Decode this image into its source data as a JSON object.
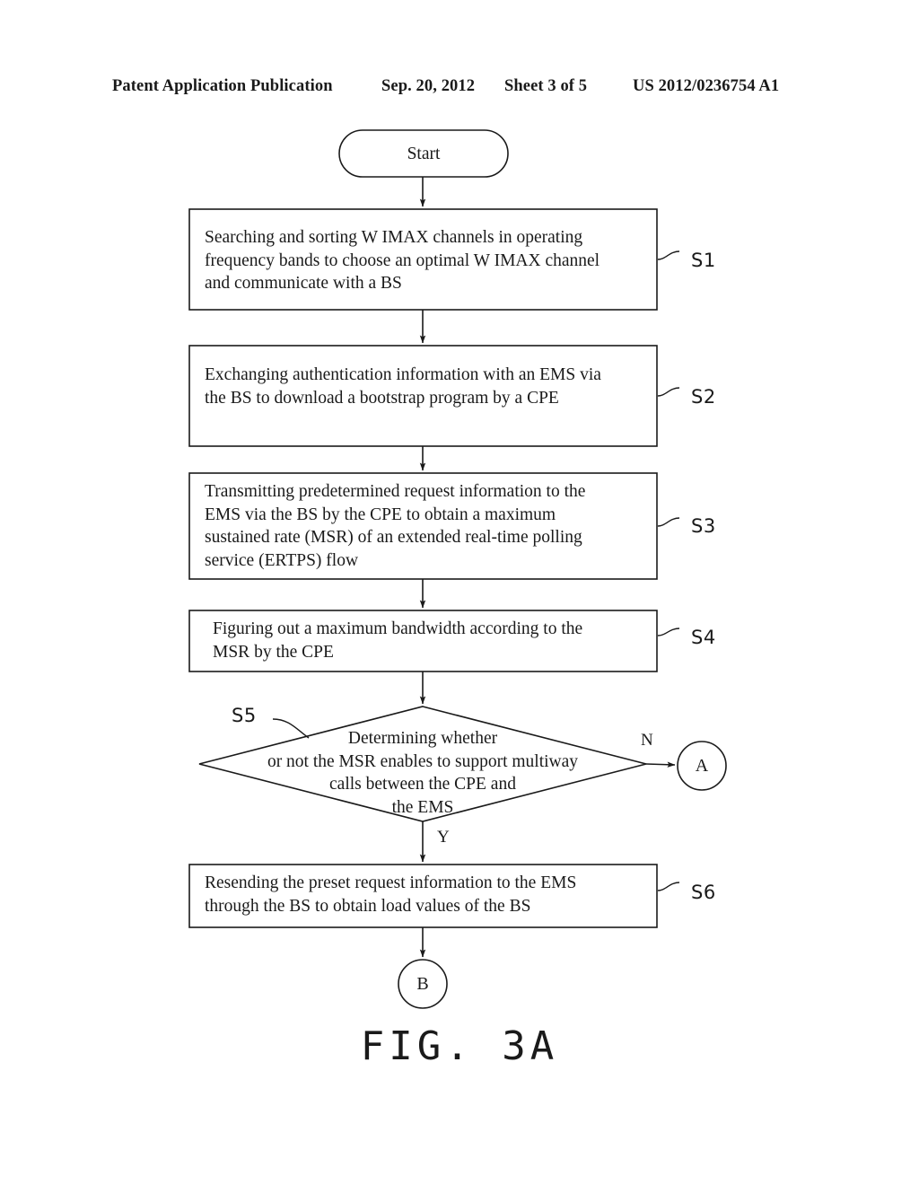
{
  "header": {
    "publication": "Patent Application Publication",
    "date": "Sep. 20, 2012",
    "sheet": "Sheet 3 of 5",
    "patent_number": "US 2012/0236754 A1"
  },
  "figure": {
    "caption": "FIG. 3A"
  },
  "flowchart": {
    "start": {
      "label": "Start",
      "shape": "stadium"
    },
    "steps": [
      {
        "tag": "S1",
        "shape": "rectangle",
        "text": "Searching and sorting W IMAX channels in operating\nfrequency bands to choose an optimal W IMAX channel\nand communicate with a BS"
      },
      {
        "tag": "S2",
        "shape": "rectangle",
        "text": "Exchanging authentication information with an EMS via\nthe BS to download a bootstrap program by a CPE"
      },
      {
        "tag": "S3",
        "shape": "rectangle",
        "text": "Transmitting predetermined request information to the\nEMS via the BS by the CPE to obtain a maximum\nsustained rate (MSR) of an extended real-time polling\nservice (ERTPS) flow"
      },
      {
        "tag": "S4",
        "shape": "rectangle",
        "text": "Figuring out a maximum bandwidth according to the\nMSR by the CPE"
      },
      {
        "tag": "S5",
        "shape": "diamond",
        "text": "Determining whether\nor not the MSR enables to support multiway\ncalls between the CPE and\nthe EMS"
      },
      {
        "tag": "S6",
        "shape": "rectangle",
        "text": "Resending the preset request information to the EMS\nthrough the BS to obtain load values of the BS"
      }
    ],
    "branches": {
      "no_label": "N",
      "yes_label": "Y"
    },
    "connectors": [
      {
        "label": "A",
        "shape": "circle"
      },
      {
        "label": "B",
        "shape": "circle"
      }
    ]
  },
  "colors": {
    "ink": "#1a1a1a",
    "paper": "#ffffff"
  }
}
